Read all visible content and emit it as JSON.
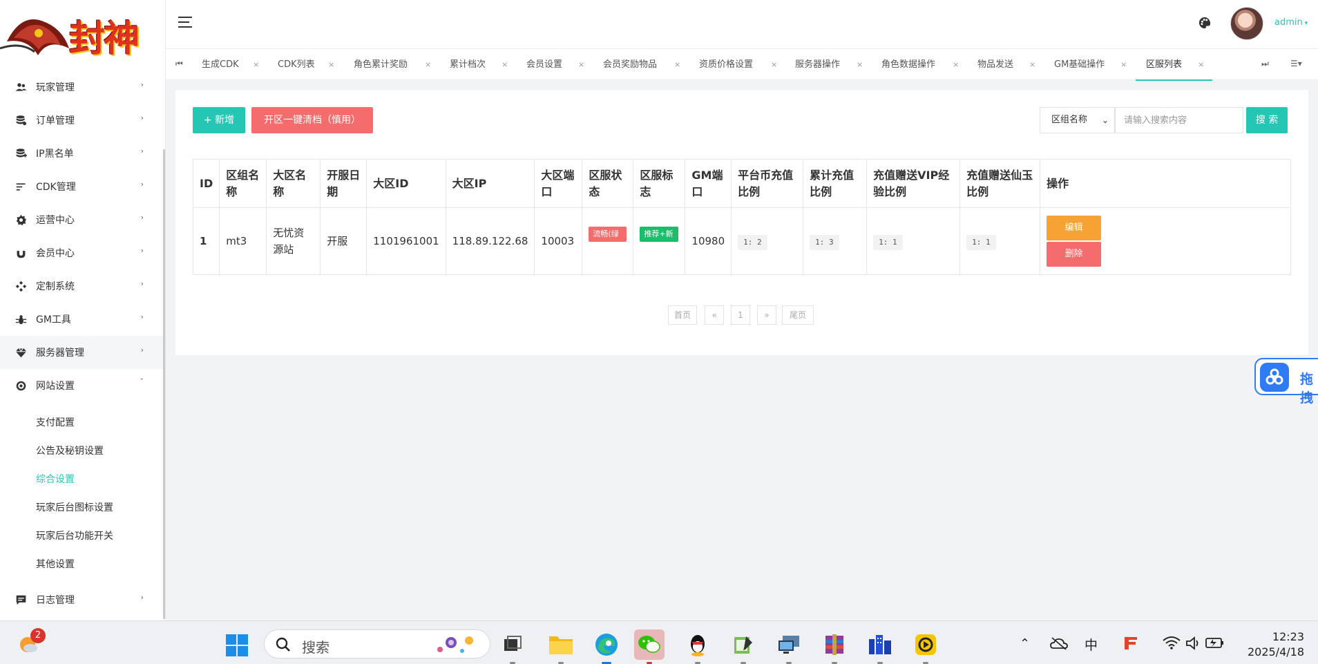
{
  "sidebar": {
    "logo_text": "封神",
    "menu": [
      {
        "label": "玩家管理",
        "icon": "users-icon"
      },
      {
        "label": "订单管理",
        "icon": "database-icon"
      },
      {
        "label": "IP黑名单",
        "icon": "database-plus-icon"
      },
      {
        "label": "CDK管理",
        "icon": "sort-lines-icon"
      },
      {
        "label": "运营中心",
        "icon": "gear-icon"
      },
      {
        "label": "会员中心",
        "icon": "magnet-icon"
      },
      {
        "label": "定制系统",
        "icon": "diamond-grid-icon"
      },
      {
        "label": "GM工具",
        "icon": "bug-icon"
      },
      {
        "label": "服务器管理",
        "icon": "gem-icon"
      },
      {
        "label": "网站设置",
        "icon": "globe-icon"
      }
    ],
    "submenu": [
      {
        "label": "支付配置",
        "active": false
      },
      {
        "label": "公告及秘钥设置",
        "active": false
      },
      {
        "label": "综合设置",
        "active": true
      },
      {
        "label": "玩家后台图标设置",
        "active": false
      },
      {
        "label": "玩家后台功能开关",
        "active": false
      },
      {
        "label": "其他设置",
        "active": false
      }
    ],
    "log_menu": {
      "label": "日志管理",
      "icon": "message-icon"
    }
  },
  "header": {
    "user": "admin"
  },
  "tabs": [
    {
      "label": "生成CDK"
    },
    {
      "label": "CDK列表"
    },
    {
      "label": "角色累计奖励"
    },
    {
      "label": "累计档次"
    },
    {
      "label": "会员设置"
    },
    {
      "label": "会员奖励物品"
    },
    {
      "label": "资质价格设置"
    },
    {
      "label": "服务器操作"
    },
    {
      "label": "角色数据操作"
    },
    {
      "label": "物品发送"
    },
    {
      "label": "GM基础操作"
    },
    {
      "label": "区服列表",
      "active": true
    }
  ],
  "toolbar": {
    "add_label": "+ 新增",
    "clear_label": "开区一键清档（慎用）",
    "search_field": "区组名称",
    "search_placeholder": "请输入搜索内容",
    "search_label": "搜 索"
  },
  "table": {
    "headers": [
      "ID",
      "区组名称",
      "大区名称",
      "开服日期",
      "大区ID",
      "大区IP",
      "大区端口",
      "区服状态",
      "区服标志",
      "GM端口",
      "平台币充值比例",
      "累计充值比例",
      "充值赠送VIP经验比例",
      "充值赠送仙玉比例",
      "操作"
    ],
    "rows": [
      {
        "id": "1",
        "group_name": "mt3",
        "region_name": "无忧资源站",
        "open_date": "开服",
        "region_id": "1101961001",
        "region_ip": "118.89.122.68",
        "region_port": "10003",
        "status": "流畅(绿色)",
        "flag": "推荐+新服",
        "gm_port": "10980",
        "coin_ratio": "1: 2",
        "cumulative_ratio": "1: 3",
        "vip_ratio": "1: 1",
        "jade_ratio": "1: 1",
        "edit_label": "编辑",
        "delete_label": "删除"
      }
    ]
  },
  "pagination": {
    "first": "首页",
    "prev": "«",
    "current": "1",
    "next": "»",
    "last": "尾页"
  },
  "float_widget": {
    "text": "拖拽"
  },
  "taskbar": {
    "badge": "2",
    "search_text": "搜索",
    "time": "12:23",
    "date": "2025/4/18",
    "ime": "中"
  },
  "colors": {
    "accent": "#26c6b4",
    "danger": "#f56c6c",
    "warning": "#f7a234",
    "success": "#19be6b"
  }
}
